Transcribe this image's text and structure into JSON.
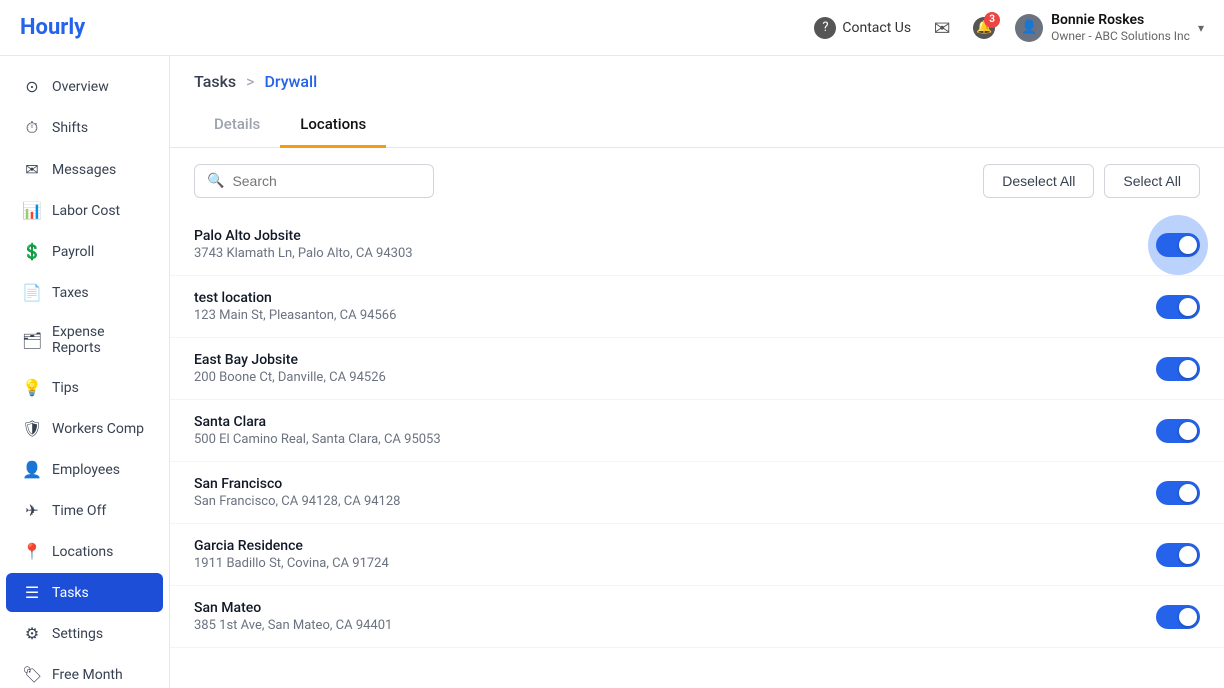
{
  "app": {
    "logo": "Hourly"
  },
  "header": {
    "contact_us": "Contact Us",
    "notifications_count": "3",
    "user_name": "Bonnie Roskes",
    "user_role": "Owner - ABC Solutions Inc"
  },
  "sidebar": {
    "items": [
      {
        "id": "overview",
        "label": "Overview",
        "icon": "⊙"
      },
      {
        "id": "shifts",
        "label": "Shifts",
        "icon": "⏱"
      },
      {
        "id": "messages",
        "label": "Messages",
        "icon": "✉"
      },
      {
        "id": "labor-cost",
        "label": "Labor Cost",
        "icon": "📊"
      },
      {
        "id": "payroll",
        "label": "Payroll",
        "icon": "💲"
      },
      {
        "id": "taxes",
        "label": "Taxes",
        "icon": "📄"
      },
      {
        "id": "expense-reports",
        "label": "Expense Reports",
        "icon": "🗂"
      },
      {
        "id": "tips",
        "label": "Tips",
        "icon": "💡"
      },
      {
        "id": "workers-comp",
        "label": "Workers Comp",
        "icon": "🛡"
      },
      {
        "id": "employees",
        "label": "Employees",
        "icon": "👤"
      },
      {
        "id": "time-off",
        "label": "Time Off",
        "icon": "✈"
      },
      {
        "id": "locations",
        "label": "Locations",
        "icon": "📍"
      },
      {
        "id": "tasks",
        "label": "Tasks",
        "icon": "☰",
        "active": true
      },
      {
        "id": "settings",
        "label": "Settings",
        "icon": "⚙"
      },
      {
        "id": "free-month",
        "label": "Free Month",
        "icon": "🏷"
      }
    ]
  },
  "breadcrumb": {
    "parent": "Tasks",
    "separator": ">",
    "current": "Drywall"
  },
  "tabs": [
    {
      "id": "details",
      "label": "Details",
      "active": false
    },
    {
      "id": "locations",
      "label": "Locations",
      "active": true
    }
  ],
  "toolbar": {
    "search_placeholder": "Search",
    "deselect_all": "Deselect All",
    "select_all": "Select All"
  },
  "locations": [
    {
      "name": "Palo Alto Jobsite",
      "address": "3743 Klamath Ln, Palo Alto, CA 94303",
      "enabled": true,
      "highlighted": true
    },
    {
      "name": "test location",
      "address": "123 Main St, Pleasanton, CA 94566",
      "enabled": true,
      "highlighted": false
    },
    {
      "name": "East Bay Jobsite",
      "address": "200 Boone Ct, Danville, CA 94526",
      "enabled": true,
      "highlighted": false
    },
    {
      "name": "Santa Clara",
      "address": "500 El Camino Real, Santa Clara, CA 95053",
      "enabled": true,
      "highlighted": false
    },
    {
      "name": "San Francisco",
      "address": "San Francisco, CA 94128, CA 94128",
      "enabled": true,
      "highlighted": false
    },
    {
      "name": "Garcia Residence",
      "address": "1911 Badillo St, Covina, CA 91724",
      "enabled": true,
      "highlighted": false
    },
    {
      "name": "San Mateo",
      "address": "385 1st Ave, San Mateo, CA 94401",
      "enabled": true,
      "highlighted": false
    }
  ]
}
